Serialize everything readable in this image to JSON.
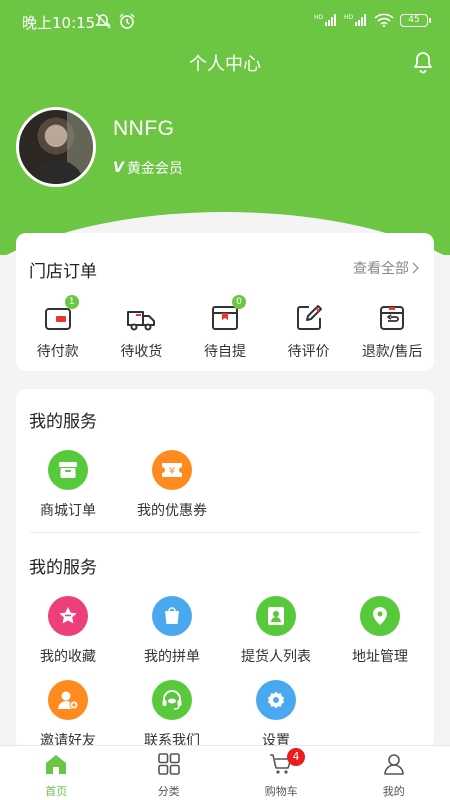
{
  "status_bar": {
    "time": "晚上10:15",
    "battery": "45"
  },
  "header": {
    "title": "个人中心"
  },
  "profile": {
    "name": "NNFG",
    "member_level": "黄金会员"
  },
  "store_orders": {
    "title": "门店订单",
    "view_all": "查看全部",
    "items": [
      {
        "label": "待付款",
        "badge": "1"
      },
      {
        "label": "待收货",
        "badge": ""
      },
      {
        "label": "待自提",
        "badge": "0"
      },
      {
        "label": "待评价",
        "badge": ""
      },
      {
        "label": "退款/售后",
        "badge": ""
      }
    ]
  },
  "services_1": {
    "title": "我的服务",
    "items": [
      {
        "label": "商城订单",
        "icon": "box-icon",
        "color": "#57c93a"
      },
      {
        "label": "我的优惠券",
        "icon": "coupon-icon",
        "color": "#ff8a1f"
      }
    ]
  },
  "services_2": {
    "title": "我的服务",
    "items": [
      {
        "label": "我的收藏",
        "icon": "star-icon",
        "color": "#ee3f7a"
      },
      {
        "label": "我的拼单",
        "icon": "bag-icon",
        "color": "#4aa8f0"
      },
      {
        "label": "提货人列表",
        "icon": "contacts-icon",
        "color": "#57c93a"
      },
      {
        "label": "地址管理",
        "icon": "location-icon",
        "color": "#57c93a"
      },
      {
        "label": "邀请好友",
        "icon": "add-user-icon",
        "color": "#ff8a1f"
      },
      {
        "label": "联系我们",
        "icon": "headset-icon",
        "color": "#57c93a"
      },
      {
        "label": "设置",
        "icon": "gear-icon",
        "color": "#4aa8f0"
      }
    ]
  },
  "tabbar": {
    "items": [
      {
        "label": "首页",
        "active": true
      },
      {
        "label": "分类",
        "active": false
      },
      {
        "label": "购物车",
        "active": false,
        "badge": "4"
      },
      {
        "label": "我的",
        "active": false
      }
    ]
  },
  "colors": {
    "brand_green": "#6cc644",
    "badge_red": "#ee1c1c"
  }
}
